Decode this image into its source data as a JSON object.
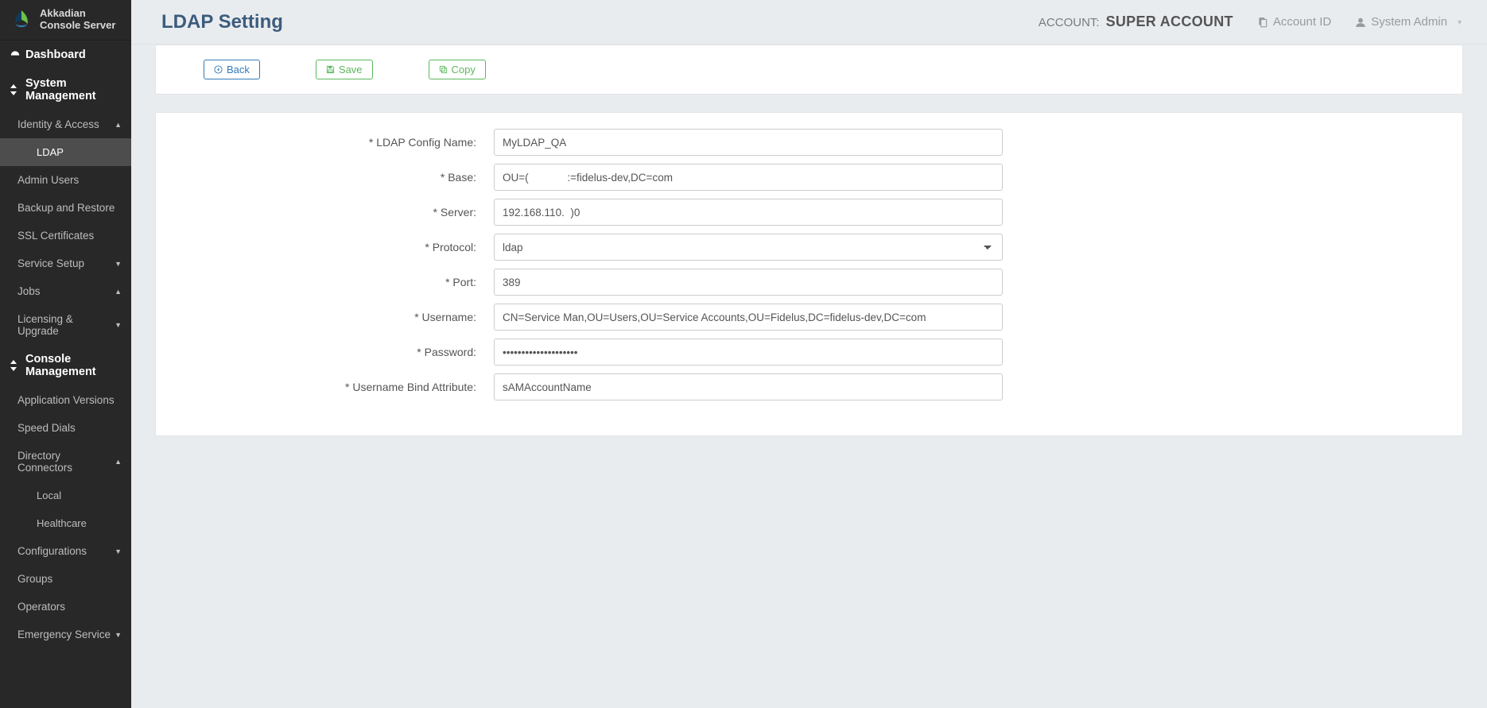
{
  "brand": {
    "line1": "Akkadian",
    "line2": "Console Server"
  },
  "sidebar": {
    "dashboard": "Dashboard",
    "system_mgmt": "System Management",
    "identity_access": "Identity & Access",
    "ldap": "LDAP",
    "admin_users": "Admin Users",
    "backup_restore": "Backup and Restore",
    "ssl_certs": "SSL Certificates",
    "service_setup": "Service Setup",
    "jobs": "Jobs",
    "licensing": "Licensing & Upgrade",
    "console_mgmt": "Console Management",
    "app_versions": "Application Versions",
    "speed_dials": "Speed Dials",
    "dir_connectors": "Directory Connectors",
    "local": "Local",
    "healthcare": "Healthcare",
    "configurations": "Configurations",
    "groups": "Groups",
    "operators": "Operators",
    "emergency": "Emergency Service"
  },
  "topbar": {
    "title": "LDAP Setting",
    "account_label": "ACCOUNT:",
    "account_name": "SUPER ACCOUNT",
    "account_id": "Account ID",
    "user_menu": "System Admin"
  },
  "buttons": {
    "back": "Back",
    "save": "Save",
    "copy": "Copy"
  },
  "form": {
    "labels": {
      "config_name": "* LDAP Config Name:",
      "base": "* Base:",
      "server": "* Server:",
      "protocol": "* Protocol:",
      "port": "* Port:",
      "username": "* Username:",
      "password": "* Password:",
      "bind_attr": "* Username Bind Attribute:"
    },
    "values": {
      "config_name": "MyLDAP_QA",
      "base": "OU=(             :=fidelus-dev,DC=com",
      "server": "192.168.110.  )0",
      "protocol": "ldap",
      "port": "389",
      "username": "CN=Service Man,OU=Users,OU=Service Accounts,OU=Fidelus,DC=fidelus-dev,DC=com",
      "password": "••••••••••••••••••••",
      "bind_attr": "sAMAccountName"
    }
  }
}
